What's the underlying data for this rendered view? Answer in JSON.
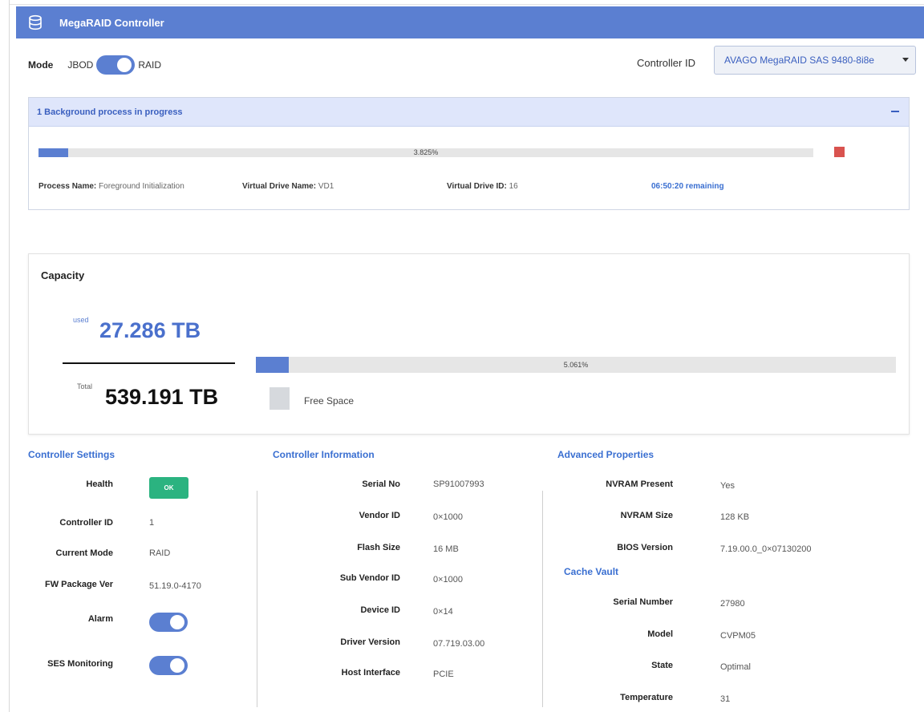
{
  "header": {
    "title": "MegaRAID Controller",
    "icon": "database-icon"
  },
  "mode": {
    "label": "Mode",
    "option_off": "JBOD",
    "option_on": "RAID",
    "selected": "RAID"
  },
  "controller_select": {
    "label": "Controller ID",
    "value": "AVAGO MegaRAID SAS 9480-8i8e"
  },
  "background": {
    "title": "1 Background process in progress",
    "progress_text": "3.825%",
    "progress_fraction": 0.03825,
    "process_name_label": "Process Name:",
    "process_name": "Foreground Initialization",
    "vd_name_label": "Virtual Drive Name:",
    "vd_name": "VD1",
    "vd_id_label": "Virtual Drive ID:",
    "vd_id": "16",
    "remaining": "06:50:20 remaining",
    "stop_color": "#d9534f"
  },
  "capacity": {
    "title": "Capacity",
    "used_label": "used",
    "used_value": "27.286 TB",
    "total_label": "Total",
    "total_value": "539.191 TB",
    "bar_text": "5.061%",
    "bar_fraction": 0.05061,
    "legend_label": "Free Space"
  },
  "controller_settings": {
    "title": "Controller Settings",
    "rows": [
      {
        "label": "Health",
        "value": "OK"
      },
      {
        "label": "Controller ID",
        "value": "1"
      },
      {
        "label": "Current Mode",
        "value": "RAID"
      },
      {
        "label": "FW Package Ver",
        "value": "51.19.0-4170"
      },
      {
        "label": "Alarm",
        "value": ""
      },
      {
        "label": "SES Monitoring",
        "value": ""
      }
    ]
  },
  "controller_information": {
    "title": "Controller Information",
    "rows": [
      {
        "label": "Serial No",
        "value": "SP91007993"
      },
      {
        "label": "Vendor ID",
        "value": "0×1000"
      },
      {
        "label": "Flash Size",
        "value": "16 MB"
      },
      {
        "label": "Sub Vendor ID",
        "value": "0×1000"
      },
      {
        "label": "Device ID",
        "value": "0×14"
      },
      {
        "label": "Driver Version",
        "value": "07.719.03.00"
      },
      {
        "label": "Host Interface",
        "value": "PCIE"
      }
    ]
  },
  "advanced_properties": {
    "title": "Advanced Properties",
    "rows": [
      {
        "label": "NVRAM Present",
        "value": "Yes"
      },
      {
        "label": "NVRAM Size",
        "value": "128 KB"
      },
      {
        "label": "BIOS Version",
        "value": "7.19.00.0_0×07130200"
      }
    ]
  },
  "cache_vault": {
    "title": "Cache Vault",
    "rows": [
      {
        "label": "Serial Number",
        "value": "27980"
      },
      {
        "label": "Model",
        "value": "CVPM05"
      },
      {
        "label": "State",
        "value": "Optimal"
      },
      {
        "label": "Temperature",
        "value": "31"
      }
    ]
  },
  "colors": {
    "accent": "#5b7fd1",
    "ok": "#2bb380",
    "link": "#3a6fd1"
  }
}
